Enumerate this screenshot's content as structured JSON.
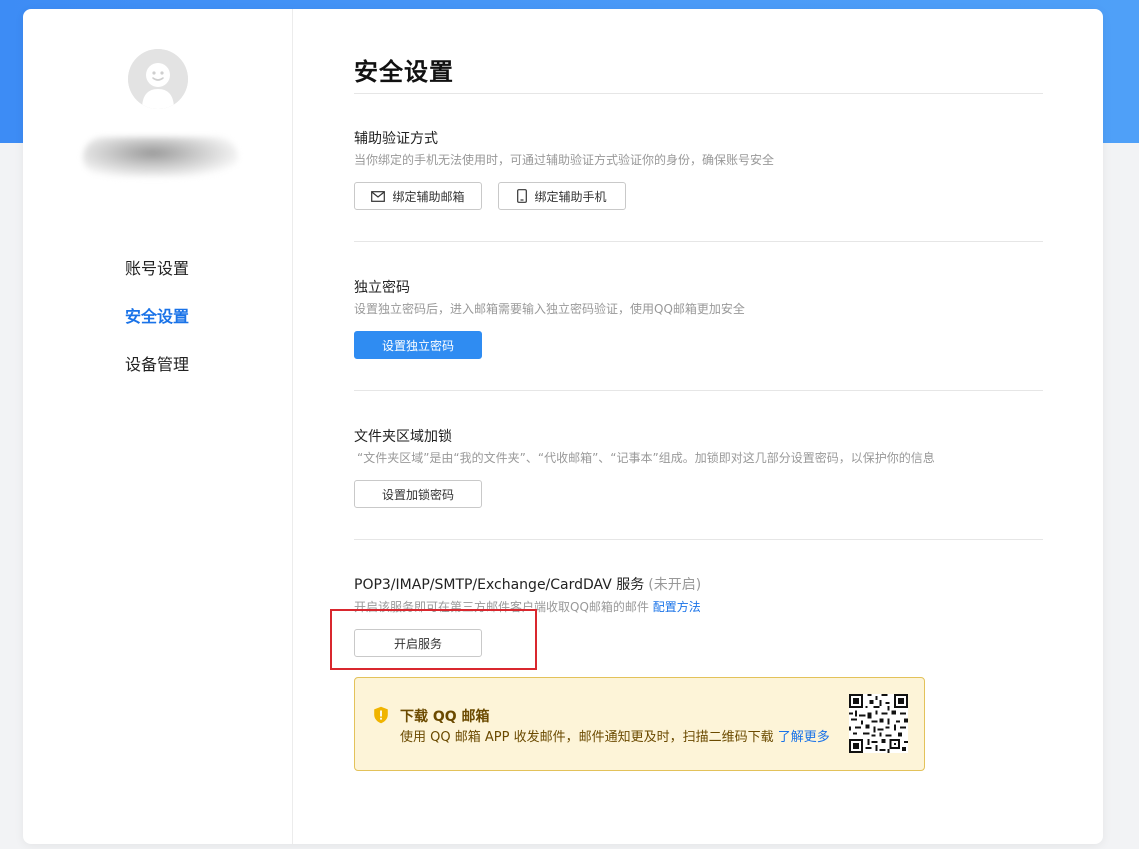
{
  "nav": {
    "items": [
      {
        "label": "账号设置"
      },
      {
        "label": "安全设置"
      },
      {
        "label": "设备管理"
      }
    ]
  },
  "page": {
    "title": "安全设置"
  },
  "sections": {
    "aux_verify": {
      "title": "辅助验证方式",
      "desc": "当你绑定的手机无法使用时，可通过辅助验证方式验证你的身份，确保账号安全",
      "bind_email_label": "绑定辅助邮箱",
      "bind_phone_label": "绑定辅助手机"
    },
    "independent_password": {
      "title": "独立密码",
      "desc": "设置独立密码后，进入邮箱需要输入独立密码验证，使用QQ邮箱更加安全",
      "button_label": "设置独立密码"
    },
    "folder_lock": {
      "title": "文件夹区域加锁",
      "desc": "“文件夹区域”是由“我的文件夹”、“代收邮箱”、“记事本”组成。加锁即对这几部分设置密码，以保护你的信息",
      "button_label": "设置加锁密码"
    },
    "pop3": {
      "title": "POP3/IMAP/SMTP/Exchange/CardDAV 服务",
      "status": "(未开启)",
      "desc": "开启该服务即可在第三方邮件客户端收取QQ邮箱的邮件",
      "config_link": "配置方法",
      "button_label": "开启服务"
    }
  },
  "banner": {
    "title": "下载 QQ 邮箱",
    "desc": "使用 QQ 邮箱 APP 收发邮件，邮件通知更及时，扫描二维码下载",
    "link": "了解更多"
  },
  "colors": {
    "accent": "#2f8cf2",
    "header_blue": "#4a9af7",
    "highlight_red": "#d9272e",
    "banner_bg": "#fdf4d8",
    "banner_border": "#e3c25a"
  },
  "icons": {
    "avatar": "default-avatar-icon",
    "email": "mail-icon",
    "phone": "phone-icon",
    "banner": "shield-alert-icon",
    "qr": "qr-code-icon"
  }
}
